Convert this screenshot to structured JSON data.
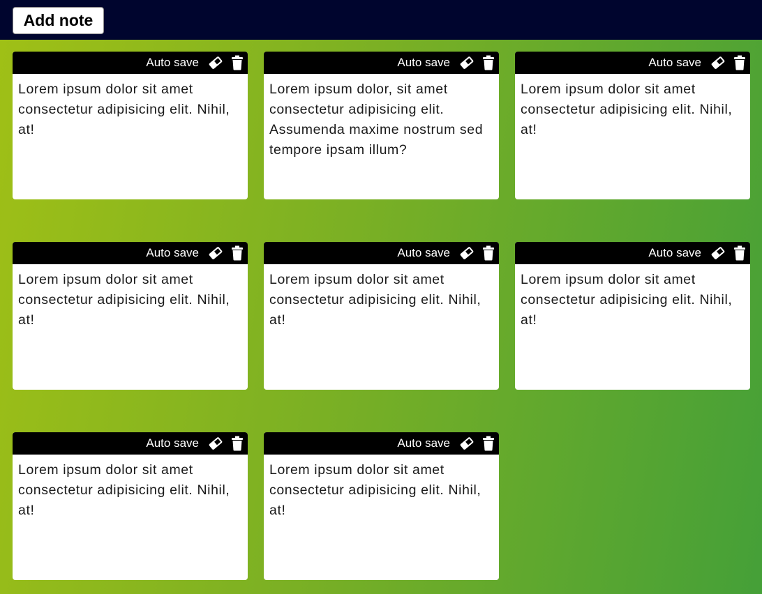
{
  "toolbar": {
    "add_note_label": "Add note"
  },
  "notes": [
    {
      "autosave_label": "Auto save",
      "text": "Lorem ipsum dolor sit amet consectetur adipisicing elit. Nihil, at!",
      "save_icon": "eraser-icon",
      "delete_icon": "trash-icon"
    },
    {
      "autosave_label": "Auto save",
      "text": "Lorem ipsum dolor, sit amet consectetur adipisicing elit. Assumenda maxime nostrum sed tempore ipsam illum?",
      "save_icon": "eraser-icon",
      "delete_icon": "trash-icon"
    },
    {
      "autosave_label": "Auto save",
      "text": "Lorem ipsum dolor sit amet consectetur adipisicing elit. Nihil, at!",
      "save_icon": "eraser-icon",
      "delete_icon": "trash-icon"
    },
    {
      "autosave_label": "Auto save",
      "text": "Lorem ipsum dolor sit amet consectetur adipisicing elit. Nihil, at!",
      "save_icon": "eraser-icon",
      "delete_icon": "trash-icon"
    },
    {
      "autosave_label": "Auto save",
      "text": "Lorem ipsum dolor sit amet consectetur adipisicing elit. Nihil, at!",
      "save_icon": "eraser-icon",
      "delete_icon": "trash-icon"
    },
    {
      "autosave_label": "Auto save",
      "text": "Lorem ipsum dolor sit amet consectetur adipisicing elit. Nihil, at!",
      "save_icon": "eraser-icon",
      "delete_icon": "trash-icon"
    },
    {
      "autosave_label": "Auto save",
      "text": "Lorem ipsum dolor sit amet consectetur adipisicing elit. Nihil, at!",
      "save_icon": "eraser-icon",
      "delete_icon": "trash-icon"
    },
    {
      "autosave_label": "Auto save",
      "text": "Lorem ipsum dolor sit amet consectetur adipisicing elit. Nihil, at!",
      "save_icon": "eraser-icon",
      "delete_icon": "trash-icon"
    }
  ],
  "colors": {
    "topbar": "#00052e",
    "note_bar": "#000000",
    "note_bg": "#ffffff",
    "gradient_start": "#a0c016",
    "gradient_end": "#45a038"
  }
}
